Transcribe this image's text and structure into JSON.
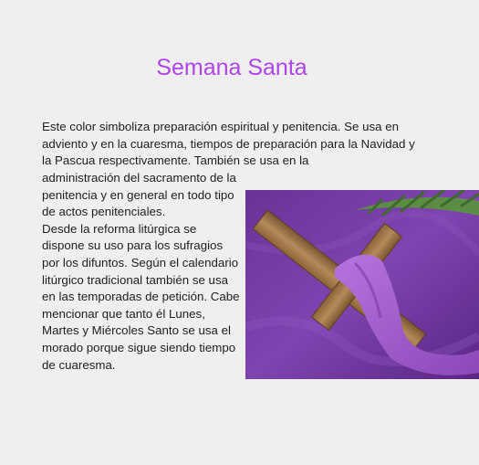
{
  "page": {
    "title": "Semana Santa",
    "intro": "Este color simboliza preparación espiritual y penitencia. Se usa en adviento y en la cuaresma, tiempos de preparación para la Navidad y la Pascua respectivamente. También se usa en la",
    "paragraph_1": "administración del sacramento de la penitencia y en general en todo tipo de actos penitenciales.",
    "paragraph_2": "Desde la reforma litúrgica se dispone su uso para los sufragios por los difuntos. Según el calendario litúrgico tradicional también se usa en las temporadas de petición. Cabe mencionar que tanto él Lunes, Martes y Miércoles Santo se usa el morado porque sigue siendo tiempo de cuaresma."
  },
  "colors": {
    "title": "#b044e6",
    "background": "#efefef",
    "cloth": "#7b3fa8",
    "sash": "#a55fcf",
    "wood": "#a07a4c",
    "leaf": "#4f7f3a"
  },
  "image": {
    "subject": "wooden-cross-with-purple-sash"
  }
}
